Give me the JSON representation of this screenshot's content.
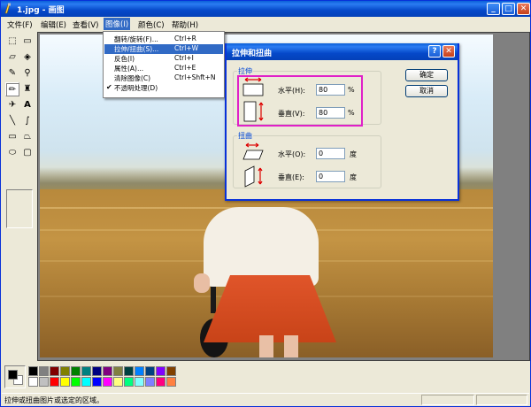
{
  "window": {
    "title": "1.jpg - 画图"
  },
  "menubar": {
    "items": [
      "文件(F)",
      "编辑(E)",
      "查看(V)",
      "图像(I)",
      "颜色(C)",
      "帮助(H)"
    ]
  },
  "image_menu": {
    "items": [
      {
        "label": "翻转/旋转(F)...",
        "shortcut": "Ctrl+R"
      },
      {
        "label": "拉伸/扭曲(S)...",
        "shortcut": "Ctrl+W"
      },
      {
        "label": "反色(I)",
        "shortcut": "Ctrl+I"
      },
      {
        "label": "属性(A)...",
        "shortcut": "Ctrl+E"
      },
      {
        "label": "清除图像(C)",
        "shortcut": "Ctrl+Shft+N"
      },
      {
        "label": "不透明处理(D)",
        "shortcut": "",
        "checked": "✔"
      }
    ]
  },
  "dialog": {
    "title": "拉伸和扭曲",
    "help": "?",
    "close": "✕",
    "stretch": {
      "group": "拉伸",
      "horizontal_label": "水平(H):",
      "horizontal_value": "80",
      "vertical_label": "垂直(V):",
      "vertical_value": "80",
      "unit": "%"
    },
    "skew": {
      "group": "扭曲",
      "horizontal_label": "水平(O):",
      "horizontal_value": "0",
      "vertical_label": "垂直(E):",
      "vertical_value": "0",
      "unit": "度"
    },
    "ok": "确定",
    "cancel": "取消"
  },
  "status": {
    "text": "拉伸或扭曲图片或选定的区域。"
  },
  "palette": {
    "foreground": "#000000",
    "background": "#ffffff",
    "colors": [
      "#000000",
      "#808080",
      "#800000",
      "#808000",
      "#008000",
      "#008080",
      "#000080",
      "#800080",
      "#808040",
      "#004040",
      "#0080ff",
      "#004080",
      "#8000ff",
      "#804000",
      "#ffffff",
      "#c0c0c0",
      "#ff0000",
      "#ffff00",
      "#00ff00",
      "#00ffff",
      "#0000ff",
      "#ff00ff",
      "#ffff80",
      "#00ff80",
      "#80ffff",
      "#8080ff",
      "#ff0080",
      "#ff8040"
    ]
  }
}
